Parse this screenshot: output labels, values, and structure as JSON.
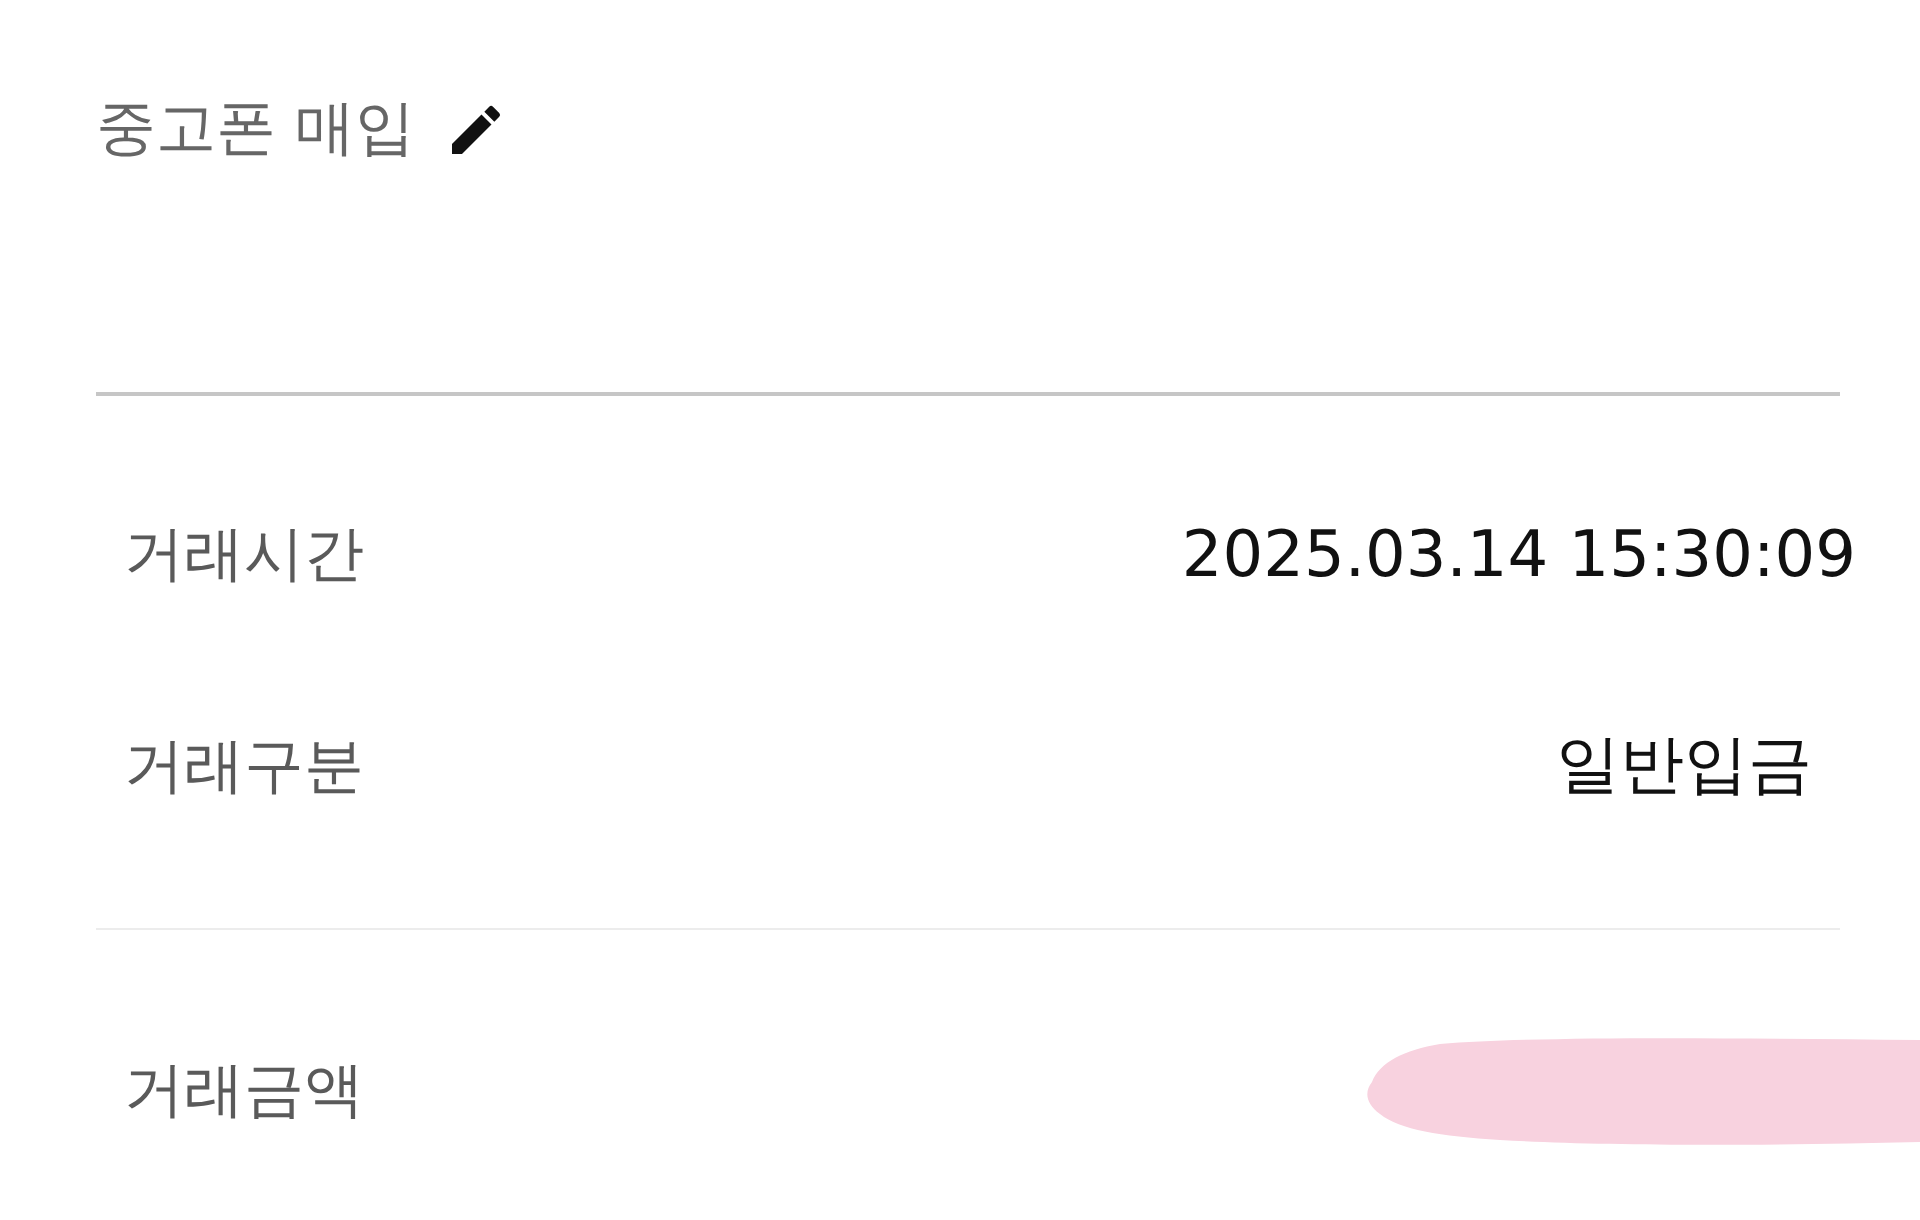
{
  "title": {
    "text": "중고폰 매입"
  },
  "details": [
    {
      "label": "거래시간",
      "value": "2025.03.14 15:30:09"
    },
    {
      "label": "거래구분",
      "value": "일반입금"
    }
  ],
  "amount": {
    "label": "거래금액",
    "value_redacted": true
  }
}
